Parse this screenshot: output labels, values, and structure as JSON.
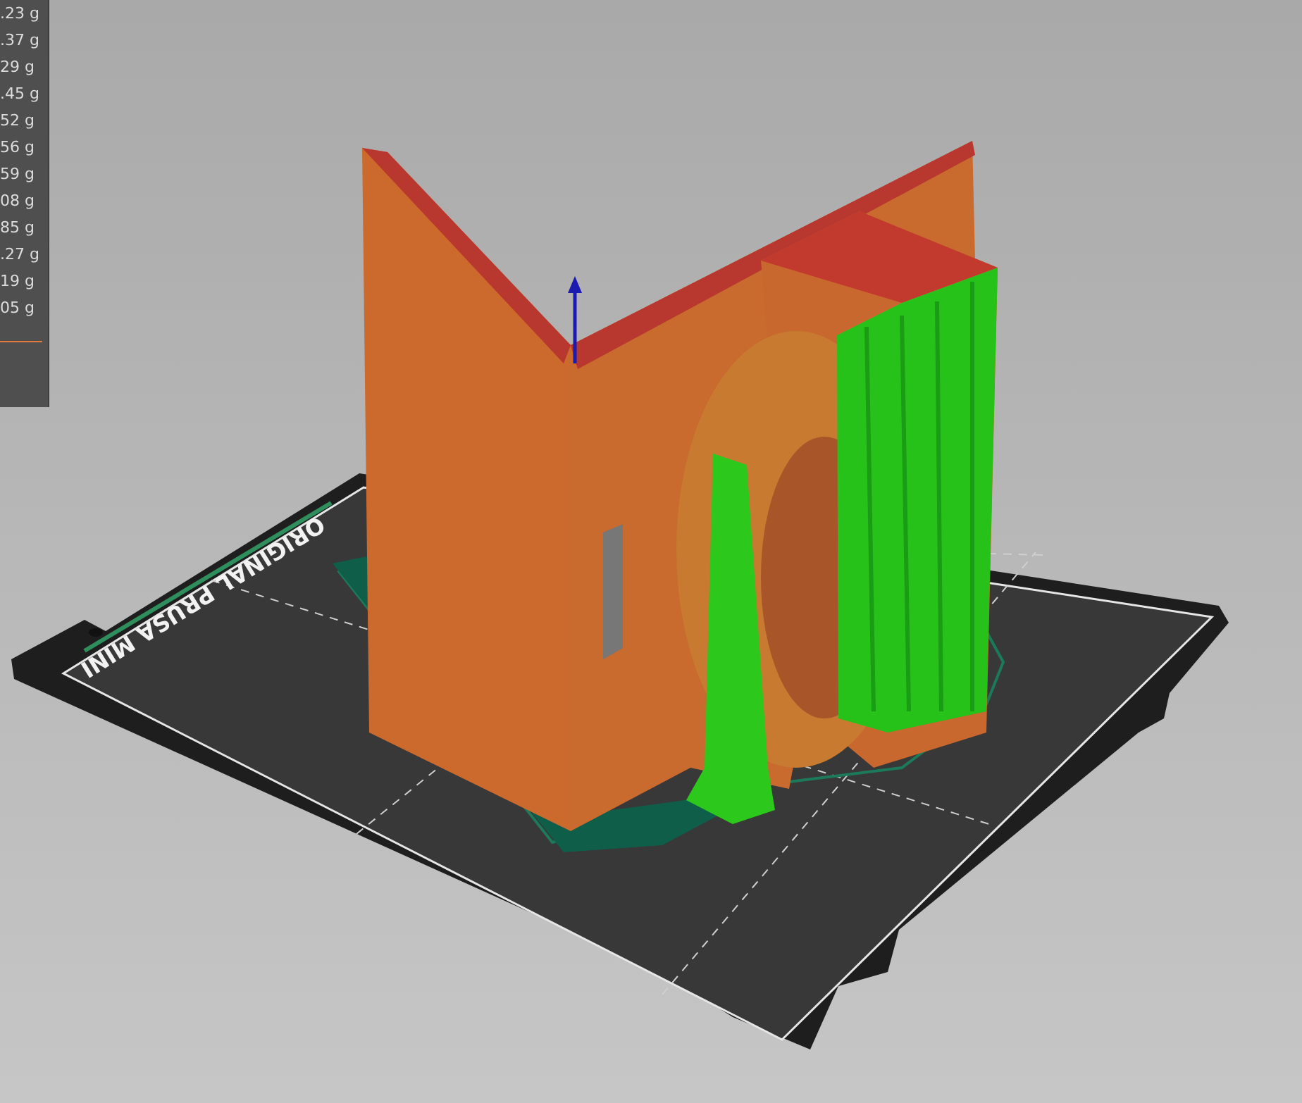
{
  "filament_panel": {
    "rows": [
      ".23 g",
      ".37 g",
      "29 g",
      ".45 g",
      "52 g",
      "56 g",
      "59 g",
      "08 g",
      "85 g",
      ".27 g",
      "19 g",
      "05 g"
    ]
  },
  "viewport": {
    "bed_label": "ORIGINAL PRUSA MINI"
  }
}
